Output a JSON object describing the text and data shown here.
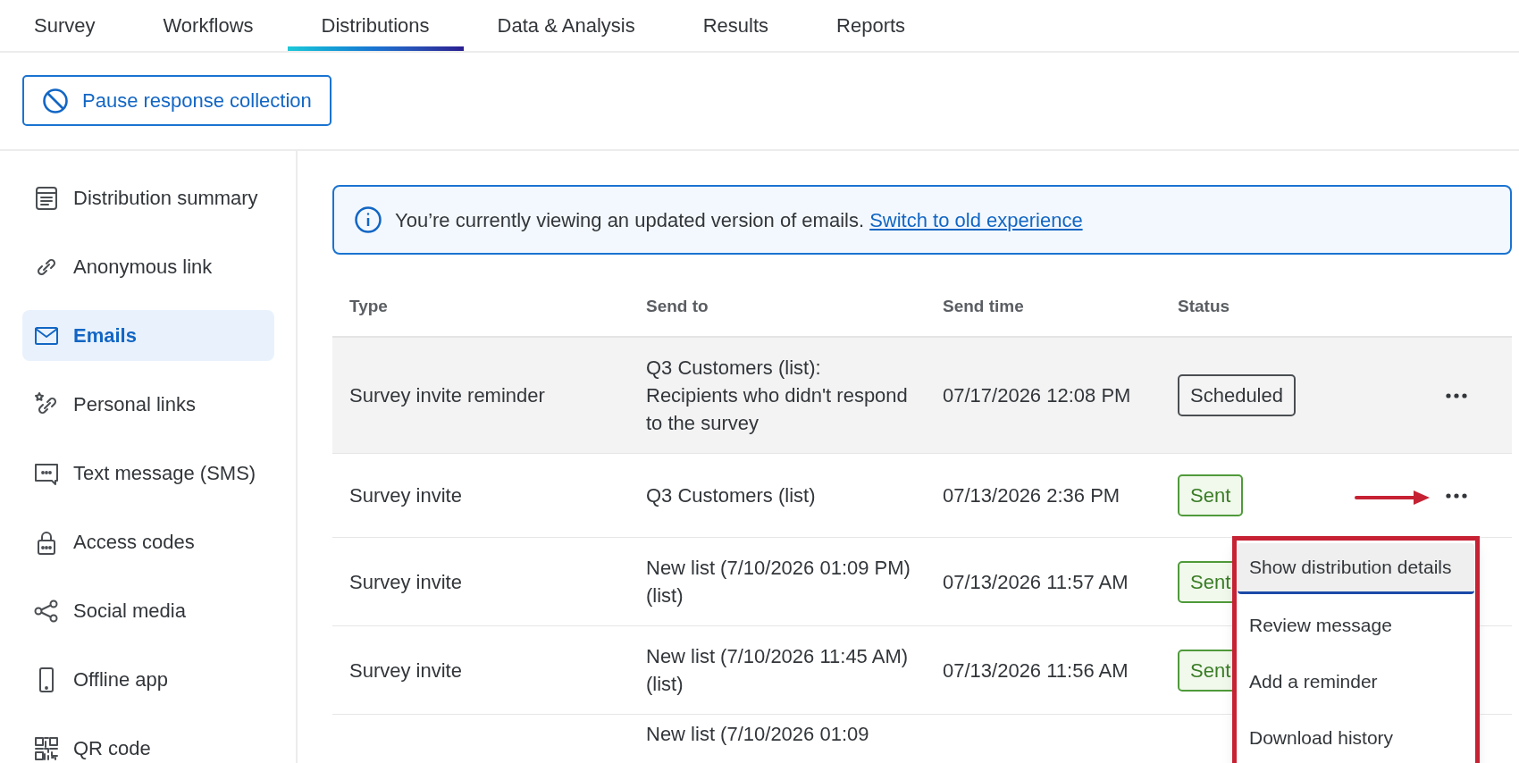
{
  "tabs": [
    {
      "label": "Survey",
      "selected": false
    },
    {
      "label": "Workflows",
      "selected": false
    },
    {
      "label": "Distributions",
      "selected": true
    },
    {
      "label": "Data & Analysis",
      "selected": false
    },
    {
      "label": "Results",
      "selected": false
    },
    {
      "label": "Reports",
      "selected": false
    }
  ],
  "pause_button": {
    "label": "Pause response collection"
  },
  "sidebar": {
    "items": [
      {
        "kind": "summary",
        "label": "Distribution summary",
        "selected": false
      },
      {
        "kind": "link",
        "label": "Anonymous link",
        "selected": false
      },
      {
        "kind": "email",
        "label": "Emails",
        "selected": true
      },
      {
        "kind": "personal",
        "label": "Personal links",
        "selected": false
      },
      {
        "kind": "sms",
        "label": "Text message (SMS)",
        "selected": false
      },
      {
        "kind": "lock",
        "label": "Access codes",
        "selected": false
      },
      {
        "kind": "share",
        "label": "Social media",
        "selected": false
      },
      {
        "kind": "phone",
        "label": "Offline app",
        "selected": false
      },
      {
        "kind": "qr",
        "label": "QR code",
        "selected": false
      }
    ]
  },
  "banner": {
    "text": "You’re currently viewing an updated version of emails.",
    "link": "Switch to old experience"
  },
  "table": {
    "columns": [
      "Type",
      "Send to",
      "Send time",
      "Status"
    ],
    "rows": [
      {
        "type": "Survey invite reminder",
        "send_to": "Q3 Customers (list): Recipients who didn't respond to the survey",
        "send_time": "07/17/2026 12:08 PM",
        "status": {
          "label": "Scheduled",
          "kind": "scheduled"
        },
        "highlighted": true
      },
      {
        "type": "Survey invite",
        "send_to": "Q3 Customers (list)",
        "send_time": "07/13/2026 2:36 PM",
        "status": {
          "label": "Sent",
          "kind": "sent"
        },
        "highlighted": false
      },
      {
        "type": "Survey invite",
        "send_to": "New list (7/10/2026 01:09 PM) (list)",
        "send_time": "07/13/2026 11:57 AM",
        "status": {
          "label": "Sent",
          "kind": "sent"
        },
        "highlighted": false
      },
      {
        "type": "Survey invite",
        "send_to": "New list (7/10/2026 11:45 AM) (list)",
        "send_time": "07/13/2026 11:56 AM",
        "status": {
          "label": "Sent",
          "kind": "sent"
        },
        "highlighted": false
      },
      {
        "send_to": "New list (7/10/2026 01:09"
      }
    ]
  },
  "context_menu": {
    "items": [
      {
        "label": "Show distribution details",
        "focused": true
      },
      {
        "label": "Review message",
        "focused": false
      },
      {
        "label": "Add a reminder",
        "focused": false
      },
      {
        "label": "Download history",
        "focused": false
      }
    ]
  }
}
